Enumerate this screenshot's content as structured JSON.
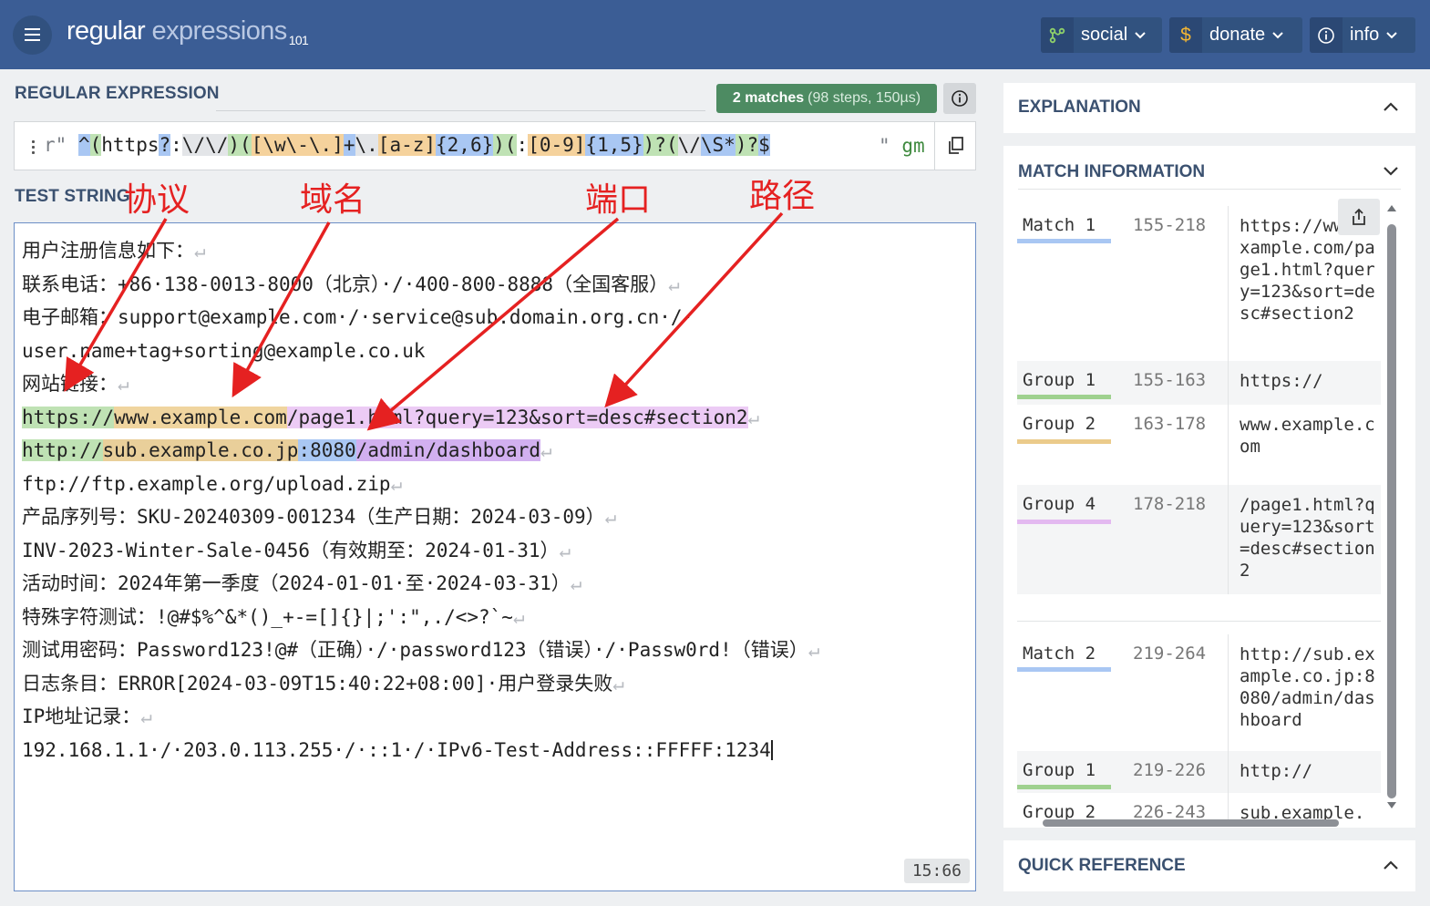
{
  "header": {
    "logo_main": "regular",
    "logo_light": " expressions",
    "logo_version": "101",
    "buttons": [
      {
        "label": "social",
        "icon": "social-icon"
      },
      {
        "label": "donate",
        "icon": "dollar-icon"
      },
      {
        "label": "info",
        "icon": "info-icon"
      }
    ]
  },
  "regex_section": {
    "label": "REGULAR EXPRESSION",
    "match_count": "2 matches",
    "match_steps": "(98 steps, 150µs)",
    "delimiter_open": "r\"",
    "delimiter_close": "\"",
    "flags": "gm",
    "tokens": [
      "^",
      "(",
      "https",
      "?",
      ":",
      "\\/\\/",
      ")",
      "(",
      "[\\w\\-\\.]",
      "+",
      "\\.",
      "[a-z]",
      "{2,6}",
      ")",
      "(",
      ":",
      "[0-9]",
      "{1,5}",
      ")?",
      "(",
      "\\/",
      "\\S*",
      ")?",
      "$"
    ]
  },
  "test_section": {
    "label": "TEST STRING",
    "cursor_position": "15:66",
    "lines": [
      "用户注册信息如下：",
      "联系电话：+86·138-0013-8000（北京）·/·400-800-8888（全国客服）",
      "电子邮箱：support@example.com·/·service@sub.domain.org.cn·/·",
      "user.name+tag+sorting@example.co.uk",
      "网站链接：",
      "https://www.example.com/page1.html?query=123&sort=desc#section2",
      "http://sub.example.co.jp:8080/admin/dashboard",
      "ftp://ftp.example.org/upload.zip",
      "产品序列号：SKU-20240309-001234（生产日期：2024-03-09）",
      "INV-2023-Winter-Sale-0456（有效期至：2024-01-31）",
      "活动时间：2024年第一季度（2024-01-01·至·2024-03-31）",
      "特殊字符测试：!@#$%^&*()_+-=[]{}|;':\",./<>?`~",
      "测试用密码：Password123!@#（正确）·/·password123（错误）·/·Passw0rd!（错误）",
      "日志条目：ERROR[2024-03-09T15:40:22+08:00]·用户登录失败",
      "IP地址记录：",
      "192.168.1.1·/·203.0.113.255·/·::1·/·IPv6-Test-Address::FFFFF:1234"
    ],
    "match1": {
      "g1": "https://",
      "g2": "www.example.com",
      "g4": "/page1.html?query=123&sort=desc#section2"
    },
    "match2": {
      "g1": "http://",
      "g2": "sub.example.co.jp",
      "g3": ":8080",
      "g4": "/admin/dashboard"
    }
  },
  "annotations": [
    "协议",
    "域名",
    "端口",
    "路径"
  ],
  "right_panel": {
    "explanation_title": "EXPLANATION",
    "match_info_title": "MATCH INFORMATION",
    "quick_ref_title": "QUICK REFERENCE",
    "rows": [
      {
        "label": "Match 1",
        "range": "155-218",
        "value": "https://www.example.com/page1.html?query=123&sort=desc#section2",
        "color": "#a9c7f3"
      },
      {
        "label": "Group 1",
        "range": "155-163",
        "value": "https://",
        "color": "#9fd18f"
      },
      {
        "label": "Group 2",
        "range": "163-178",
        "value": "www.example.com",
        "color": "#ebcb8b"
      },
      {
        "label": "Group 4",
        "range": "178-218",
        "value": "/page1.html?query=123&sort=desc#section2",
        "color": "#e3b9f0"
      },
      {
        "label": "Match 2",
        "range": "219-264",
        "value": "http://sub.example.co.jp:8080/admin/dashboard",
        "color": "#a9c7f3"
      },
      {
        "label": "Group 1",
        "range": "219-226",
        "value": "http://",
        "color": "#9fd18f"
      },
      {
        "label": "Group 2",
        "range": "226-243",
        "value": "sub.example.",
        "color": "#ebcb8b"
      }
    ]
  },
  "colors": {
    "header": "#3b5d95",
    "accent_green": "#4d8b62",
    "annotation_red": "#e52121"
  }
}
